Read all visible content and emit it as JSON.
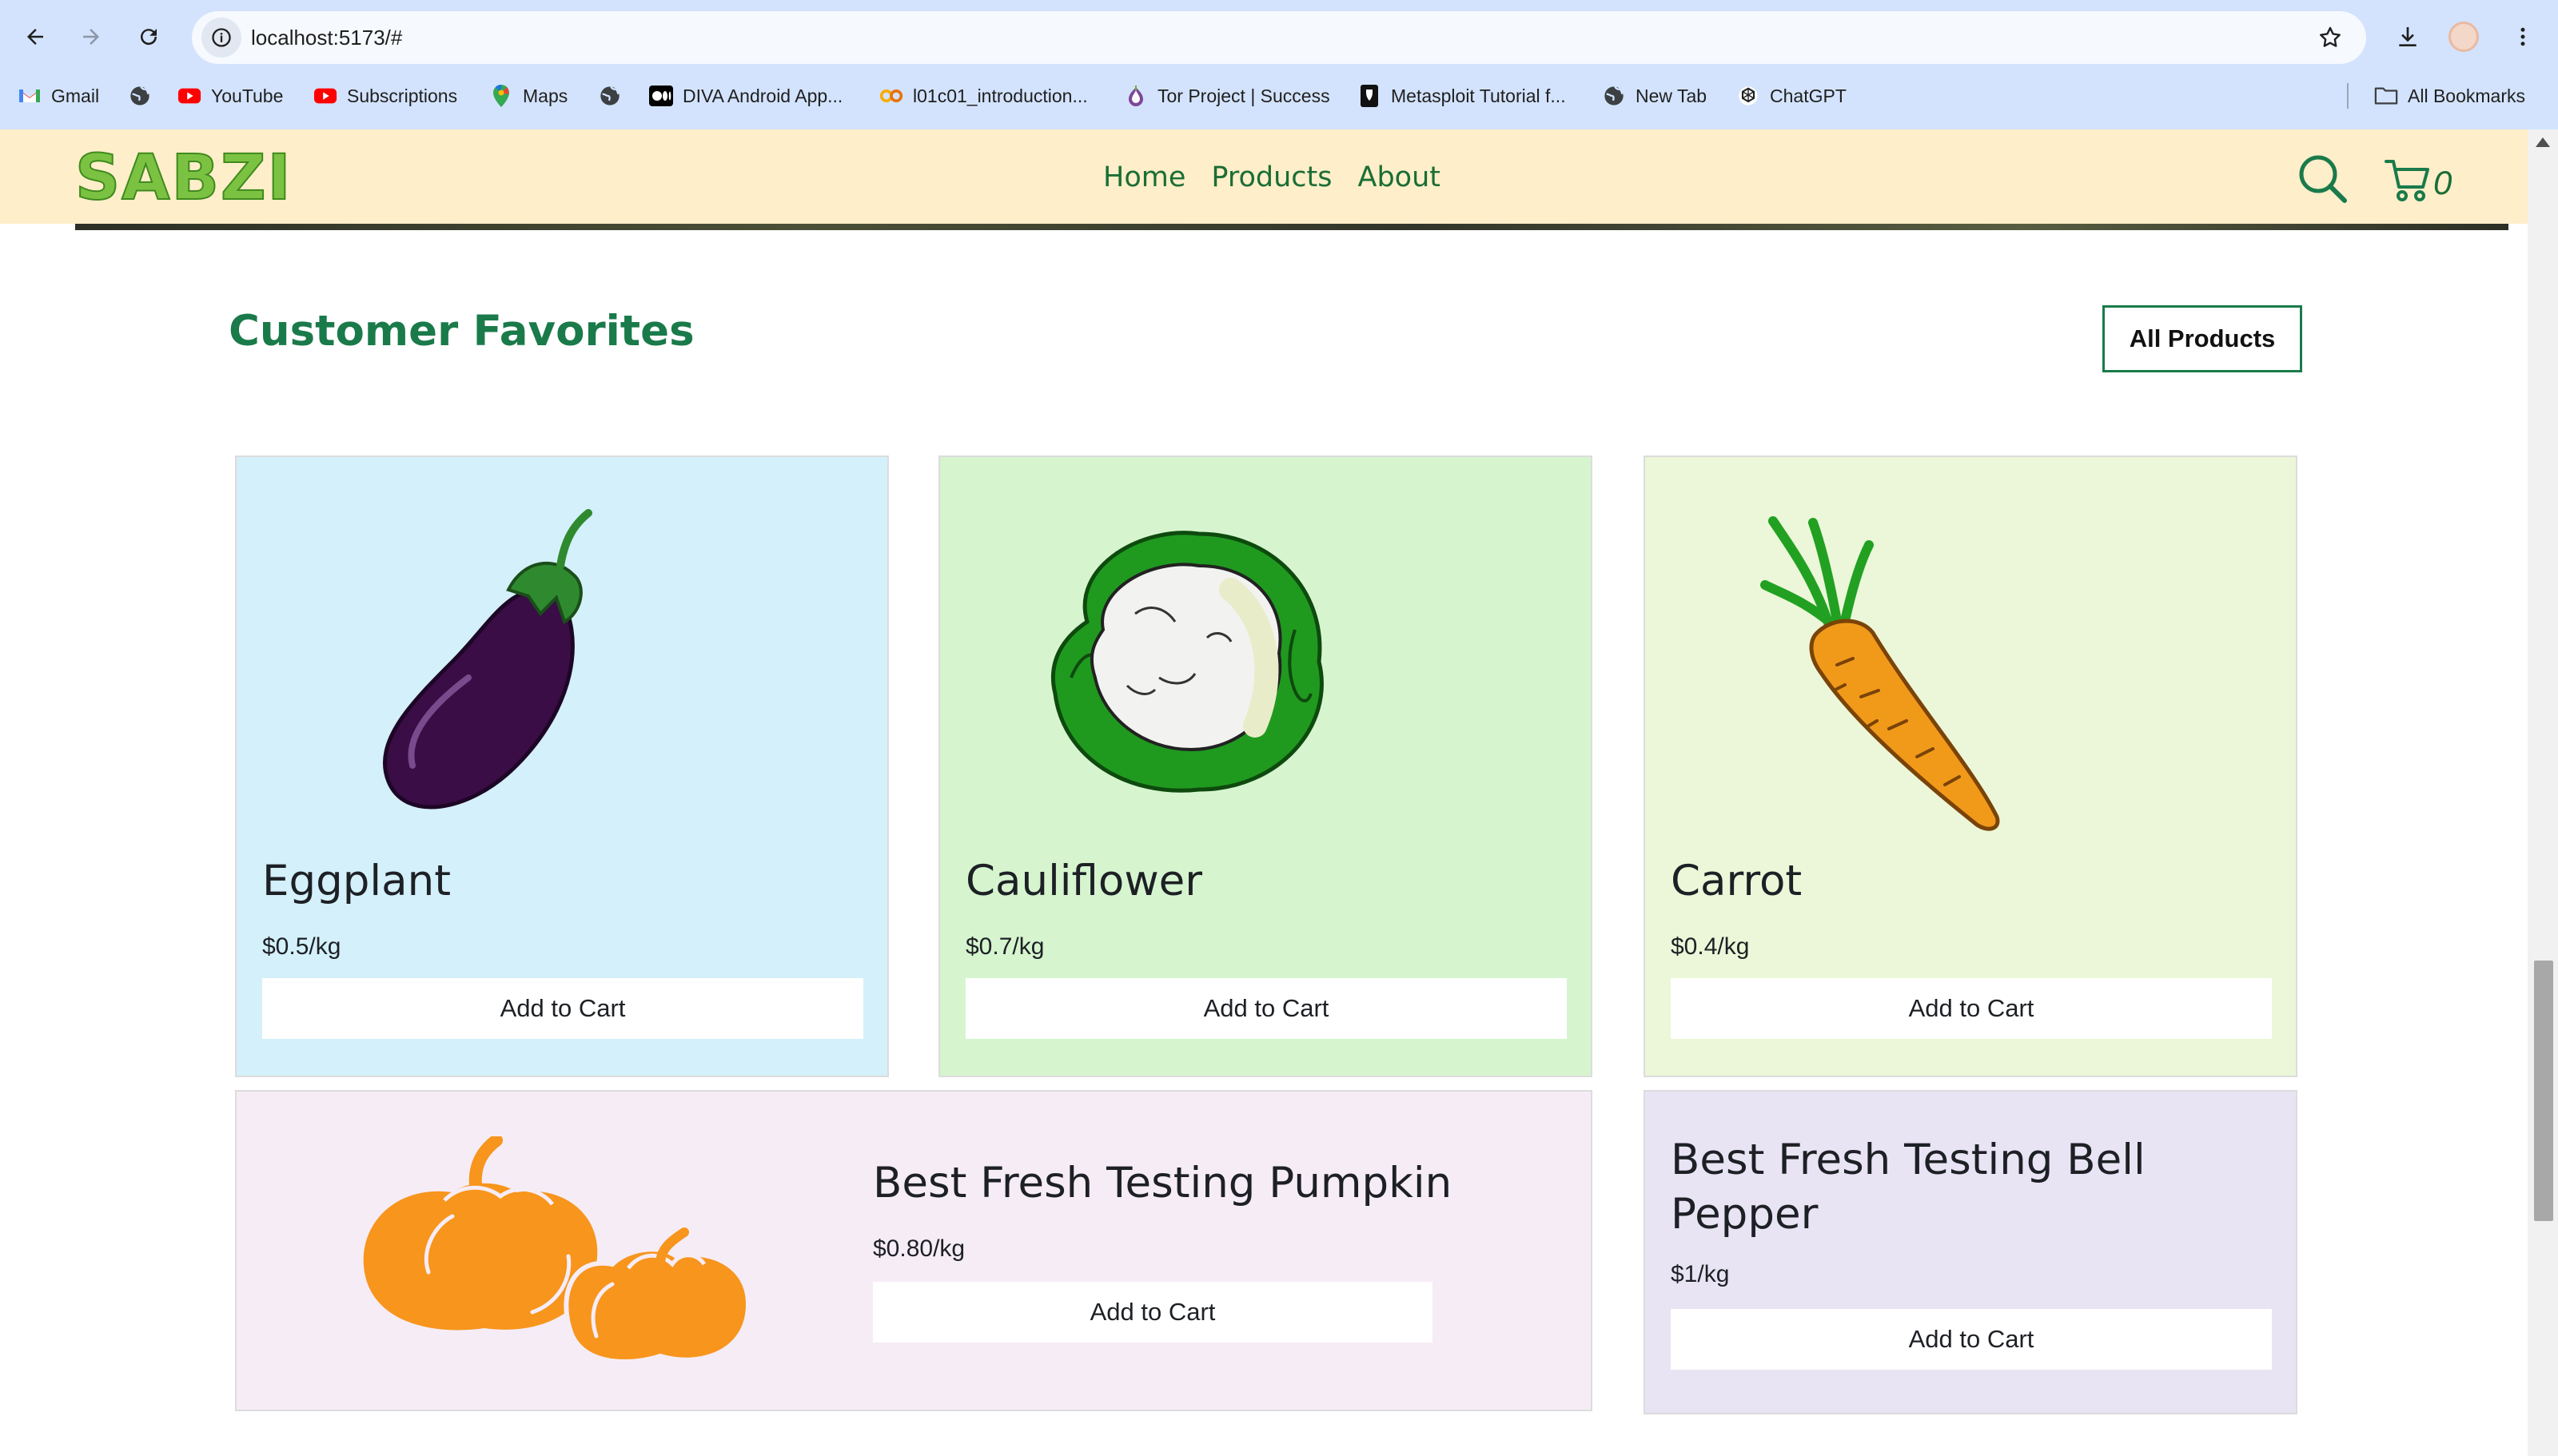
{
  "browser": {
    "url": "localhost:5173/#",
    "bookmarks": [
      {
        "label": "Gmail",
        "icon": "gmail-icon"
      },
      {
        "label": "",
        "icon": "globe-icon"
      },
      {
        "label": "YouTube",
        "icon": "youtube-icon"
      },
      {
        "label": "Subscriptions",
        "icon": "youtube-icon"
      },
      {
        "label": "Maps",
        "icon": "maps-pin-icon"
      },
      {
        "label": "",
        "icon": "globe-icon"
      },
      {
        "label": "DIVA Android App...",
        "icon": "medium-icon"
      },
      {
        "label": "l01c01_introduction...",
        "icon": "colab-icon"
      },
      {
        "label": "Tor Project | Success",
        "icon": "tor-onion-icon"
      },
      {
        "label": "Metasploit Tutorial f...",
        "icon": "metasploit-icon"
      },
      {
        "label": "New Tab",
        "icon": "globe-icon"
      },
      {
        "label": "ChatGPT",
        "icon": "chatgpt-icon"
      }
    ],
    "all_bookmarks": "All Bookmarks"
  },
  "site": {
    "logo": "SABZI",
    "nav": [
      "Home",
      "Products",
      "About"
    ],
    "cart_count": "0",
    "accent": "#1a7a4a",
    "header_bg": "#feeec9"
  },
  "section": {
    "title": "Customer Favorites",
    "all_products_label": "All Products"
  },
  "products": [
    {
      "name": "Eggplant",
      "price": "$0.5/kg",
      "button": "Add to Cart",
      "bg": "#d4f0fa",
      "image": "eggplant-image"
    },
    {
      "name": "Cauliflower",
      "price": "$0.7/kg",
      "button": "Add to Cart",
      "bg": "#d6f5cf",
      "image": "cauliflower-image"
    },
    {
      "name": "Carrot",
      "price": "$0.4/kg",
      "button": "Add to Cart",
      "bg": "#ebf7d8",
      "image": "carrot-image"
    },
    {
      "name": "Best Fresh Testing Pumpkin",
      "price": "$0.80/kg",
      "button": "Add to Cart",
      "bg": "#f6ecf6",
      "image": "pumpkin-image"
    },
    {
      "name": "Best Fresh Testing Bell Pepper",
      "price": "$1/kg",
      "button": "Add to Cart",
      "bg": "#e8e4f4",
      "image": ""
    }
  ]
}
